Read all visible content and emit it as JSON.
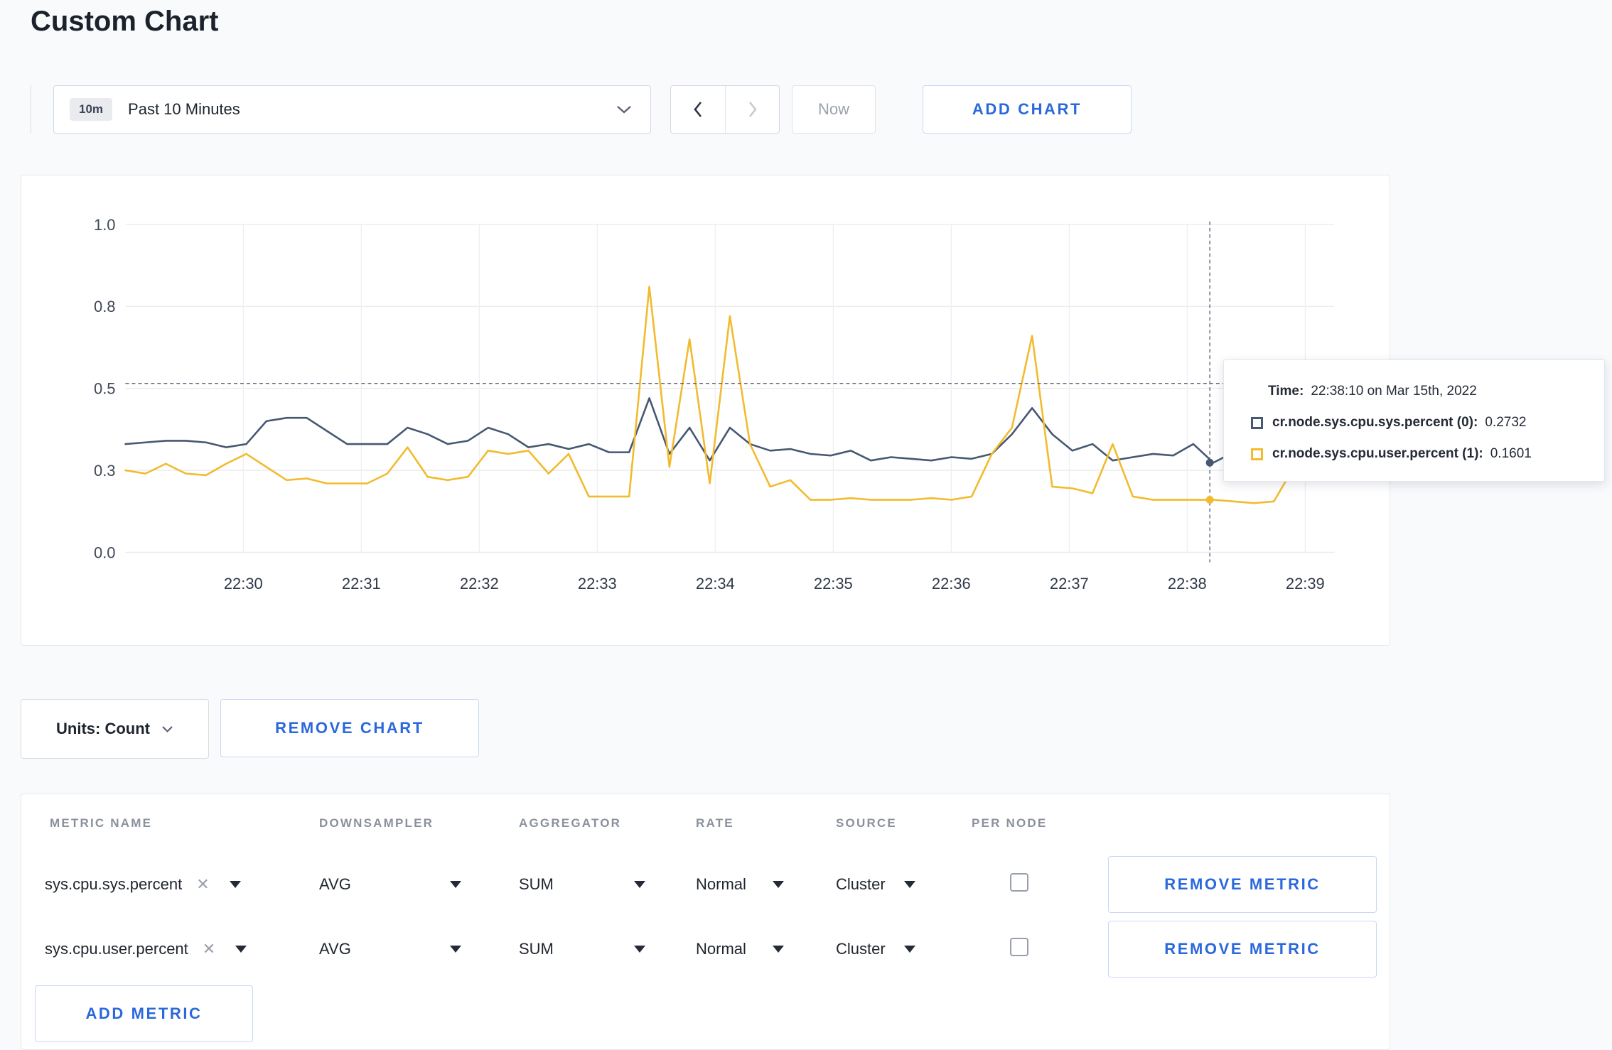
{
  "page": {
    "title": "Custom Chart"
  },
  "toolbar": {
    "time_range": {
      "badge": "10m",
      "label": "Past 10 Minutes"
    },
    "now_label": "Now",
    "add_chart_label": "ADD CHART"
  },
  "chart": {
    "tooltip": {
      "time_label": "Time:",
      "time_value": "22:38:10 on Mar 15th, 2022",
      "series": [
        {
          "label": "cr.node.sys.cpu.sys.percent (0):",
          "value": "0.2732",
          "color": "#475872"
        },
        {
          "label": "cr.node.sys.cpu.user.percent (1):",
          "value": "0.1601",
          "color": "#f2bb2e"
        }
      ]
    }
  },
  "chart_data": {
    "type": "line",
    "title": "",
    "xlabel": "",
    "ylabel": "",
    "ylim": [
      0,
      1
    ],
    "grid": true,
    "legend_position": "none",
    "x_ticks": [
      "22:30",
      "22:31",
      "22:32",
      "22:33",
      "22:34",
      "22:35",
      "22:36",
      "22:37",
      "22:38",
      "22:39"
    ],
    "y_ticks": [
      {
        "value": 0.0,
        "label": "0.0"
      },
      {
        "value": 0.25,
        "label": "0.3"
      },
      {
        "value": 0.5,
        "label": "0.5"
      },
      {
        "value": 0.75,
        "label": "0.8"
      },
      {
        "value": 1.0,
        "label": "1.0"
      }
    ],
    "series": [
      {
        "name": "cr.node.sys.cpu.sys.percent",
        "color": "#475872",
        "values": [
          0.33,
          0.335,
          0.34,
          0.34,
          0.335,
          0.32,
          0.33,
          0.4,
          0.41,
          0.41,
          0.37,
          0.33,
          0.33,
          0.33,
          0.38,
          0.36,
          0.33,
          0.34,
          0.38,
          0.36,
          0.32,
          0.33,
          0.315,
          0.33,
          0.305,
          0.305,
          0.47,
          0.3,
          0.38,
          0.28,
          0.38,
          0.33,
          0.31,
          0.315,
          0.3,
          0.295,
          0.31,
          0.28,
          0.29,
          0.285,
          0.28,
          0.29,
          0.285,
          0.3,
          0.36,
          0.44,
          0.36,
          0.31,
          0.33,
          0.28,
          0.29,
          0.3,
          0.295,
          0.33,
          0.2732,
          0.305,
          0.31,
          0.3,
          0.31,
          0.315,
          0.33
        ]
      },
      {
        "name": "cr.node.sys.cpu.user.percent",
        "color": "#f2bb2e",
        "values": [
          0.25,
          0.24,
          0.27,
          0.24,
          0.235,
          0.27,
          0.3,
          0.26,
          0.22,
          0.225,
          0.21,
          0.21,
          0.21,
          0.24,
          0.32,
          0.23,
          0.22,
          0.23,
          0.31,
          0.3,
          0.31,
          0.24,
          0.3,
          0.17,
          0.17,
          0.17,
          0.81,
          0.26,
          0.65,
          0.21,
          0.72,
          0.33,
          0.2,
          0.22,
          0.16,
          0.16,
          0.165,
          0.16,
          0.16,
          0.16,
          0.165,
          0.16,
          0.17,
          0.3,
          0.38,
          0.66,
          0.2,
          0.195,
          0.18,
          0.33,
          0.17,
          0.16,
          0.16,
          0.16,
          0.1601,
          0.155,
          0.15,
          0.155,
          0.26,
          0.22,
          0.27
        ]
      }
    ],
    "crosshair": {
      "x_fraction": 0.897,
      "y_value": 0.515,
      "point_values": [
        0.2732,
        0.1601
      ]
    }
  },
  "chart_controls": {
    "units_label": "Units: Count",
    "remove_chart_label": "REMOVE CHART"
  },
  "metrics_table": {
    "headers": [
      "METRIC NAME",
      "DOWNSAMPLER",
      "AGGREGATOR",
      "RATE",
      "SOURCE",
      "PER NODE"
    ],
    "rows": [
      {
        "metric": "sys.cpu.sys.percent",
        "downsampler": "AVG",
        "aggregator": "SUM",
        "rate": "Normal",
        "source": "Cluster",
        "per_node": false,
        "remove_label": "REMOVE METRIC"
      },
      {
        "metric": "sys.cpu.user.percent",
        "downsampler": "AVG",
        "aggregator": "SUM",
        "rate": "Normal",
        "source": "Cluster",
        "per_node": false,
        "remove_label": "REMOVE METRIC"
      }
    ],
    "add_metric_label": "ADD METRIC"
  }
}
